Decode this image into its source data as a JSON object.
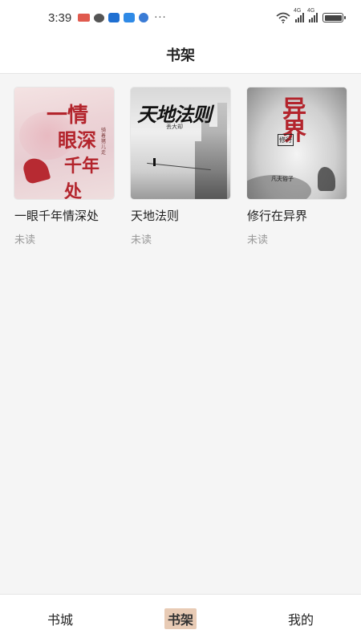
{
  "status_bar": {
    "time": "3:39",
    "icons": [
      "red-app-icon",
      "chat-icon",
      "blue-app-icon",
      "blue-app-icon-2",
      "globe-icon"
    ],
    "more": "···",
    "network_1": "4G",
    "network_2": "4G"
  },
  "header": {
    "title": "书架"
  },
  "shelf": {
    "books": [
      {
        "title": "一眼千年情深处",
        "status": "未读",
        "cover": {
          "line1": "一情",
          "line2": "眼深",
          "line3": "千年处",
          "side": "骑着猪儿走"
        }
      },
      {
        "title": "天地法则",
        "status": "未读",
        "cover": {
          "title": "天地法则",
          "author": "丢大却"
        }
      },
      {
        "title": "修行在异界",
        "status": "未读",
        "cover": {
          "title": "异界",
          "tag": "修行",
          "author": "凡夫俗子"
        }
      }
    ]
  },
  "bottom_nav": {
    "items": [
      {
        "label": "书城",
        "active": false
      },
      {
        "label": "书架",
        "active": true
      },
      {
        "label": "我的",
        "active": false
      }
    ]
  }
}
